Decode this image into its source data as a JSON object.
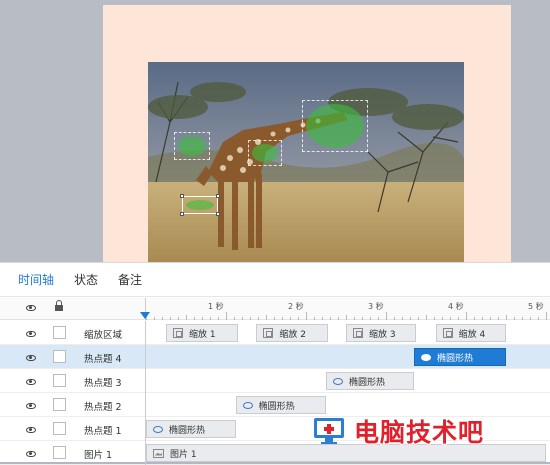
{
  "tabs": [
    {
      "label": "时间轴",
      "active": true
    },
    {
      "label": "状态",
      "active": false
    },
    {
      "label": "备注",
      "active": false
    }
  ],
  "ruler": {
    "labels": [
      "1 秒",
      "2 秒",
      "3 秒",
      "4 秒",
      "5 秒"
    ]
  },
  "tracks": [
    {
      "name": "缩放区域",
      "selected": false,
      "clips": [
        {
          "label": "缩放 1",
          "icon": "zoom-icon",
          "start": 0.25,
          "end": 1.15
        },
        {
          "label": "缩放 2",
          "icon": "zoom-icon",
          "start": 1.38,
          "end": 2.28
        },
        {
          "label": "缩放 3",
          "icon": "zoom-icon",
          "start": 2.5,
          "end": 3.38
        },
        {
          "label": "缩放 4",
          "icon": "zoom-icon",
          "start": 3.62,
          "end": 4.5
        }
      ]
    },
    {
      "name": "热点题 4",
      "selected": true,
      "clips": [
        {
          "label": "椭圆形热",
          "icon": "ellipse-icon",
          "start": 3.35,
          "end": 4.5,
          "active": true
        }
      ]
    },
    {
      "name": "热点题 3",
      "selected": false,
      "clips": [
        {
          "label": "椭圆形热",
          "icon": "ellipse-icon",
          "start": 2.25,
          "end": 3.35
        }
      ]
    },
    {
      "name": "热点题 2",
      "selected": false,
      "clips": [
        {
          "label": "椭圆形热",
          "icon": "ellipse-icon",
          "start": 1.12,
          "end": 2.25
        }
      ]
    },
    {
      "name": "热点题 1",
      "selected": false,
      "clips": [
        {
          "label": "椭圆形热",
          "icon": "ellipse-icon",
          "start": 0.0,
          "end": 1.12
        }
      ]
    },
    {
      "name": "图片 1",
      "selected": false,
      "clips": [
        {
          "label": "图片 1",
          "icon": "image-icon",
          "start": 0.0,
          "end": 5.0
        }
      ]
    }
  ],
  "watermark": {
    "text": "电脑技术吧"
  },
  "colors": {
    "accent": "#1e7bd6",
    "hotspot": "#3cbe3c",
    "watermark": "#e0212b"
  }
}
